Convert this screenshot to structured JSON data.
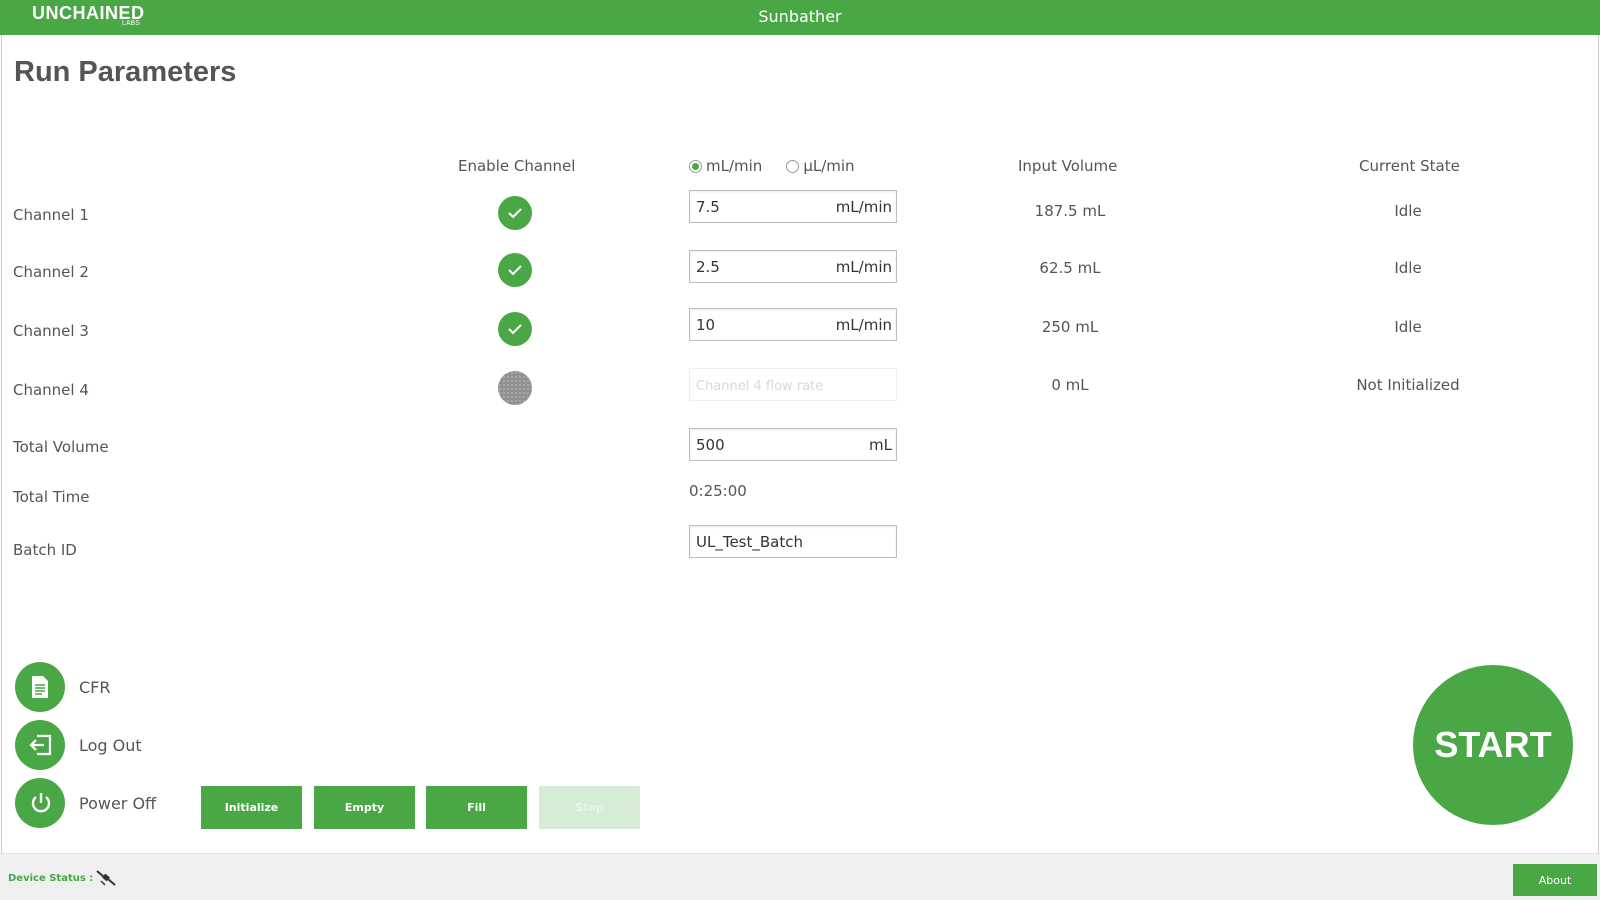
{
  "app": {
    "logo": "UNCHAINED",
    "logo_sub": "LABS",
    "title": "Sunbather"
  },
  "page_title": "Run Parameters",
  "columns": {
    "enable_channel": "Enable Channel",
    "unit_ml": "mL/min",
    "unit_ul": "µL/min",
    "selected_unit": "mL/min",
    "input_volume": "Input Volume",
    "current_state": "Current State"
  },
  "channels": [
    {
      "label": "Channel 1",
      "enabled": true,
      "flow_rate": "7.5",
      "unit": "mL/min",
      "input_volume": "187.5 mL",
      "state": "Idle"
    },
    {
      "label": "Channel 2",
      "enabled": true,
      "flow_rate": "2.5",
      "unit": "mL/min",
      "input_volume": "62.5 mL",
      "state": "Idle"
    },
    {
      "label": "Channel 3",
      "enabled": true,
      "flow_rate": "10",
      "unit": "mL/min",
      "input_volume": "250 mL",
      "state": "Idle"
    },
    {
      "label": "Channel 4",
      "enabled": false,
      "flow_rate": "",
      "placeholder": "Channel 4 flow rate",
      "unit": "",
      "input_volume": "0 mL",
      "state": "Not Initialized"
    }
  ],
  "total_volume": {
    "label": "Total Volume",
    "value": "500",
    "unit": "mL"
  },
  "total_time": {
    "label": "Total Time",
    "value": "0:25:00"
  },
  "batch_id": {
    "label": "Batch ID",
    "value": "UL_Test_Batch"
  },
  "side_actions": [
    {
      "label": "CFR",
      "icon": "document-icon"
    },
    {
      "label": "Log Out",
      "icon": "logout-icon"
    },
    {
      "label": "Power Off",
      "icon": "power-icon"
    }
  ],
  "actions": [
    {
      "label": "Initialize",
      "enabled": true
    },
    {
      "label": "Empty",
      "enabled": true
    },
    {
      "label": "Fill",
      "enabled": true
    },
    {
      "label": "Stop",
      "enabled": false
    }
  ],
  "start_label": "START",
  "status": {
    "label": "Device Status :",
    "icon": "disconnected-plug-icon"
  },
  "about_label": "About",
  "colors": {
    "brand_green": "#4aa746",
    "disabled_green": "#d6ecd4",
    "disabled_check": "#8f8f8f"
  }
}
